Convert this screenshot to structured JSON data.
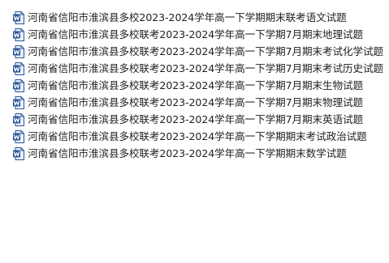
{
  "files": [
    {
      "name": "河南省信阳市淮滨县多校2023-2024学年高一下学期期末联考语文试题",
      "icon": "word-doc-icon"
    },
    {
      "name": "河南省信阳市淮滨县多校联考2023-2024学年高一下学期7月期末地理试题",
      "icon": "word-doc-icon"
    },
    {
      "name": "河南省信阳市淮滨县多校联考2023-2024学年高一下学期7月期末考试化学试题",
      "icon": "word-doc-icon"
    },
    {
      "name": "河南省信阳市淮滨县多校联考2023-2024学年高一下学期7月期末考试历史试题",
      "icon": "word-doc-icon"
    },
    {
      "name": "河南省信阳市淮滨县多校联考2023-2024学年高一下学期7月期末生物试题",
      "icon": "word-doc-icon"
    },
    {
      "name": "河南省信阳市淮滨县多校联考2023-2024学年高一下学期7月期末物理试题",
      "icon": "word-doc-icon"
    },
    {
      "name": "河南省信阳市淮滨县多校联考2023-2024学年高一下学期7月期末英语试题",
      "icon": "word-doc-icon"
    },
    {
      "name": "河南省信阳市淮滨县多校联考2023-2024学年高一下学期期末考试政治试题",
      "icon": "word-doc-icon"
    },
    {
      "name": "河南省信阳市淮滨县多校联考2023-2024学年高一下学期期末数学试题",
      "icon": "word-doc-icon"
    }
  ],
  "colors": {
    "icon_blue": "#2b579a",
    "icon_light": "#e8eef8"
  }
}
